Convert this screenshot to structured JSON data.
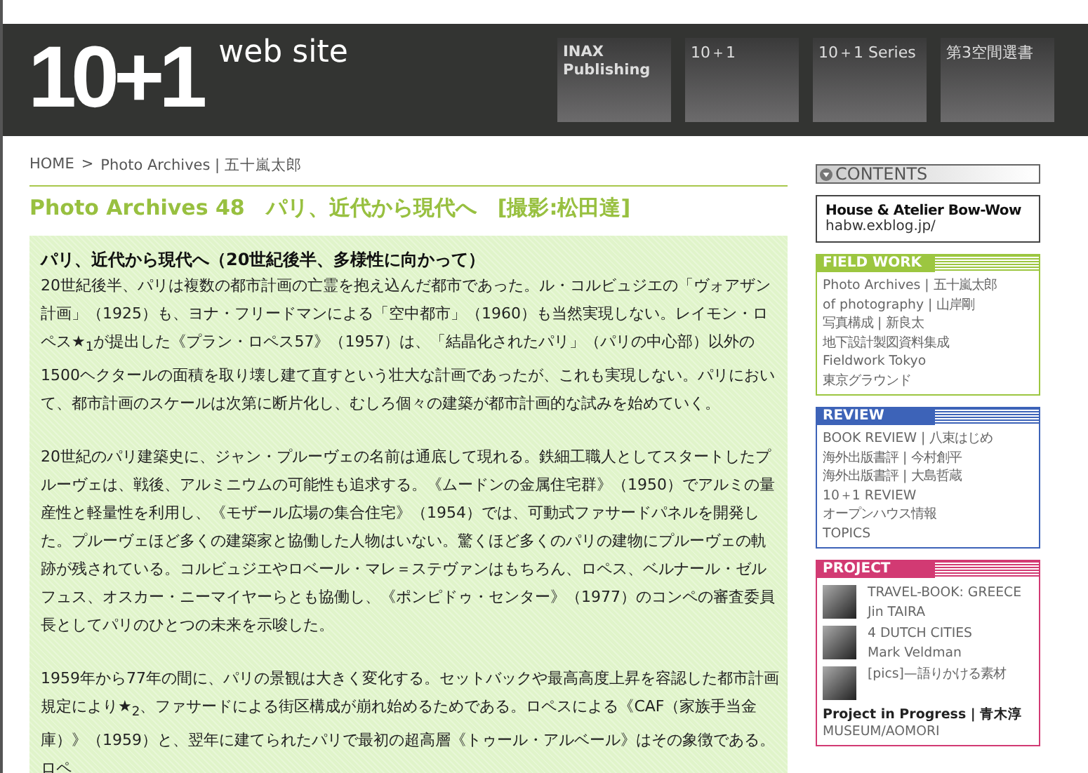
{
  "header": {
    "logo": "10+1",
    "logo_suffix": "web site",
    "nav": [
      {
        "label": "INAX Publishing",
        "kind": "brand"
      },
      {
        "label": "10＋1",
        "kind": "link"
      },
      {
        "label": "10＋1 Series",
        "kind": "link"
      },
      {
        "label": "第3空間選書",
        "kind": "link"
      }
    ]
  },
  "breadcrumb": {
    "items": [
      "HOME",
      "Photo Archives | 五十嵐太郎"
    ],
    "separator": ">"
  },
  "title": "Photo Archives 48　パリ、近代から現代へ　[撮影:松田達]",
  "article": {
    "heading": "パリ、近代から現代へ（20世紀後半、多様性に向かって）",
    "paragraphs": [
      "20世紀後半、パリは複数の都市計画の亡霊を抱え込んだ都市であった。ル・コルビュジエの「ヴォアザン計画」（1925）も、ヨナ・フリードマンによる「空中都市」（1960）も当然実現しない。レイモン・ロペス★$_{1}$が提出した《プラン・ロペス57》（1957）は、「結晶化されたパリ」（パリの中心部）以外の1500ヘクタールの面積を取り壊し建て直すという壮大な計画であったが、これも実現しない。パリにおいて、都市計画のスケールは次第に断片化し、むしろ個々の建築が都市計画的な試みを始めていく。",
      "20世紀のパリ建築史に、ジャン・プルーヴェの名前は通底して現れる。鉄細工職人としてスタートしたプルーヴェは、戦後、アルミニウムの可能性も追求する。《ムードンの金属住宅群》（1950）でアルミの量産性と軽量性を利用し、《モザール広場の集合住宅》（1954）では、可動式ファサードパネルを開発した。プルーヴェほど多くの建築家と協働した人物はいない。驚くほど多くのパリの建物にプルーヴェの軌跡が残されている。コルビュジエやロベール・マレ＝ステヴァンはもちろん、ロペス、ベルナール・ゼルフュス、オスカー・ニーマイヤーらとも協働し、《ポンピドゥ・センター》（1977）のコンペの審査委員長としてパリのひとつの未来を示唆した。",
      "1959年から77年の間に、パリの景観は大きく変化する。セットバックや最高高度上昇を容認した都市計画規定により★$_{2}$、ファサードによる街区構成が崩れ始めるためである。ロペスによる《CAF（家族手当金庫）》（1959）と、翌年に建てられたパリで最初の超高層《トゥール・アルベール》はその象徴である。ロペ"
    ]
  },
  "sidebar": {
    "contents_label": "CONTENTS",
    "featured": {
      "title": "House & Atelier Bow-Wow",
      "url": "habw.exblog.jp/"
    },
    "sections": [
      {
        "title": "FIELD WORK",
        "color": "#9cc640",
        "links": [
          "Photo Archives | 五十嵐太郎",
          "of photography | 山岸剛",
          "写真構成 | 新良太",
          "地下設計製図資料集成",
          "Fieldwork Tokyo",
          "東京グラウンド"
        ]
      },
      {
        "title": "REVIEW",
        "color": "#3d63b8",
        "links": [
          "BOOK REVIEW | 八束はじめ",
          "海外出版書評 | 今村創平",
          "海外出版書評 | 大島哲蔵",
          "10＋1 REVIEW",
          "オープンハウス情報",
          "TOPICS"
        ]
      },
      {
        "title": "PROJECT",
        "color": "#d23a73",
        "projects": [
          {
            "title": "TRAVEL-BOOK: GREECE",
            "author": "Jin TAIRA"
          },
          {
            "title": "4 DUTCH CITIES",
            "author": "Mark Veldman"
          },
          {
            "title": "[pics]—語りかける素材"
          }
        ],
        "footer": {
          "title": "Project in Progress | 青木淳",
          "subtitle": "MUSEUM/AOMORI"
        }
      }
    ]
  }
}
